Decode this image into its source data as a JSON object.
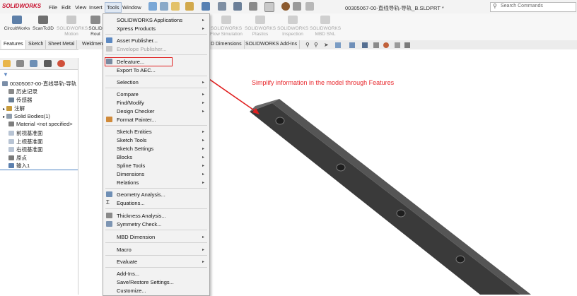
{
  "app": {
    "logo": "SOLIDWORKS",
    "file_title": "00305067-00-直线导轨-导轨_B.SLDPRT *",
    "search_placeholder": "Search Commands"
  },
  "menubar": [
    "File",
    "Edit",
    "View",
    "Insert",
    "Tools",
    "Window"
  ],
  "commands": [
    {
      "label": "CircuitWorks",
      "dim": false
    },
    {
      "label": "ScanTo3D",
      "dim": false
    },
    {
      "label": "SOLIDWORKS\nMotion",
      "dim": true
    },
    {
      "label": "SOLID\nRout",
      "dim": false
    },
    {
      "label": "SOLIDWORKS\nFlow Simulation",
      "dim": true
    },
    {
      "label": "SOLIDWORKS\nPlastics",
      "dim": true
    },
    {
      "label": "SOLIDWORKS\nInspection",
      "dim": true
    },
    {
      "label": "SOLIDWORKS\nMBD SNL",
      "dim": true
    }
  ],
  "tabs": [
    "Features",
    "Sketch",
    "Sheet Metal",
    "Weldment",
    "D Dimensions",
    "SOLIDWORKS Add-Ins"
  ],
  "tree": {
    "root": "00305067-00-直线导轨-导轨",
    "items": [
      "历史记录",
      "传感器",
      "注解",
      "Solid Bodies(1)",
      "Material <not specified>",
      "前视基准面",
      "上视基准面",
      "右视基准面",
      "原点",
      "输入1"
    ]
  },
  "tools_menu": {
    "items": [
      {
        "label": "SOLIDWORKS Applications",
        "arrow": true
      },
      {
        "label": "Xpress Products",
        "arrow": true
      },
      {
        "label": "Asset Publisher..."
      },
      {
        "label": "Envelope Publisher...",
        "dim": true
      },
      {
        "label": "Defeature..."
      },
      {
        "label": "Export To AEC..."
      },
      {
        "label": "Selection",
        "arrow": true
      },
      {
        "label": "Compare",
        "arrow": true
      },
      {
        "label": "Find/Modify",
        "arrow": true
      },
      {
        "label": "Design Checker",
        "arrow": true
      },
      {
        "label": "Format Painter..."
      },
      {
        "label": "Sketch Entities",
        "arrow": true
      },
      {
        "label": "Sketch Tools",
        "arrow": true
      },
      {
        "label": "Sketch Settings",
        "arrow": true
      },
      {
        "label": "Blocks",
        "arrow": true
      },
      {
        "label": "Spline Tools",
        "arrow": true
      },
      {
        "label": "Dimensions",
        "arrow": true
      },
      {
        "label": "Relations",
        "arrow": true
      },
      {
        "label": "Geometry Analysis..."
      },
      {
        "label": "Equations..."
      },
      {
        "label": "Thickness Analysis..."
      },
      {
        "label": "Symmetry Check..."
      },
      {
        "label": "MBD Dimension",
        "arrow": true
      },
      {
        "label": "Macro",
        "arrow": true
      },
      {
        "label": "Evaluate",
        "arrow": true
      },
      {
        "label": "Add-Ins..."
      },
      {
        "label": "Save/Restore Settings..."
      },
      {
        "label": "Customize..."
      }
    ]
  },
  "annotation": "Simplify information in the model through Features",
  "colors": {
    "accent_red": "#e02020",
    "rail": "#3a3a3a"
  }
}
